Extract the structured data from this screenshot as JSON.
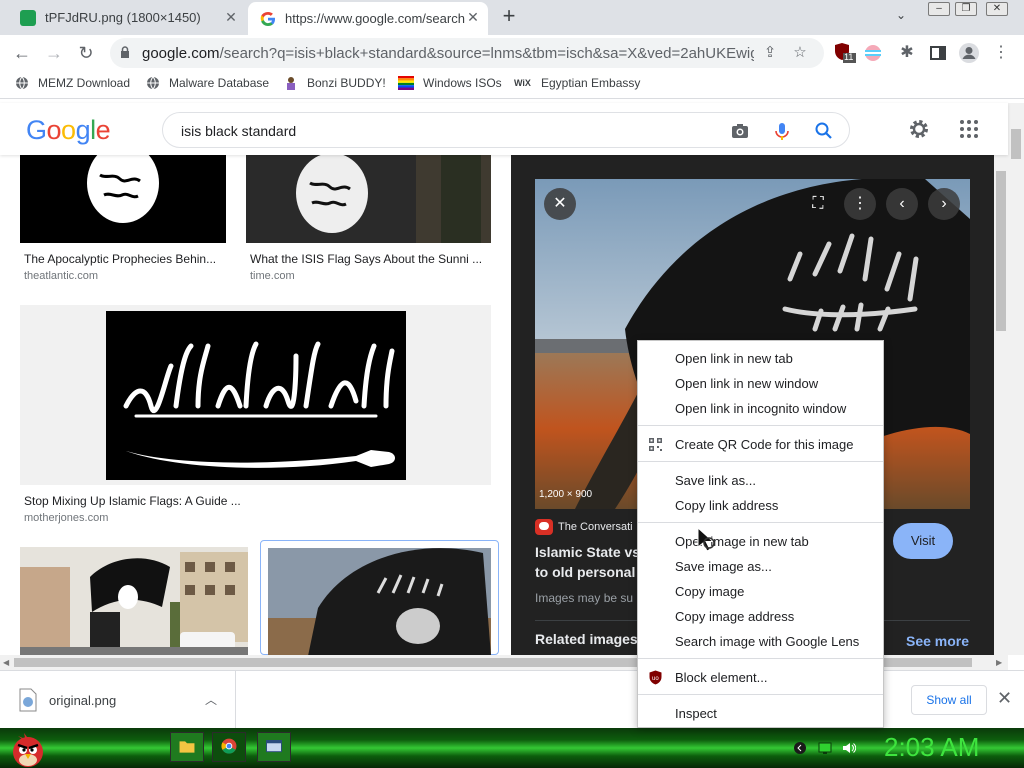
{
  "tabs": [
    {
      "title": "tPFJdRU.png (1800×1450)"
    },
    {
      "title": "https://www.google.com/search?"
    }
  ],
  "toolbar": {
    "url_host": "google.com",
    "url_path": "/search?q=isis+black+standard&source=lnms&tbm=isch&sa=X&ved=2ahUKEwigno...",
    "extension_badge": "11"
  },
  "bookmarks": [
    {
      "label": "MEMZ Download"
    },
    {
      "label": "Malware Database"
    },
    {
      "label": "Bonzi BUDDY!"
    },
    {
      "label": "Windows ISOs"
    },
    {
      "label": "Egyptian Embassy"
    }
  ],
  "google": {
    "logo": [
      "G",
      "o",
      "o",
      "g",
      "l",
      "e"
    ],
    "query": "isis black standard"
  },
  "results": [
    {
      "title": "The Apocalyptic Prophecies Behin...",
      "source": "theatlantic.com"
    },
    {
      "title": "What the ISIS Flag Says About the Sunni ...",
      "source": "time.com"
    },
    {
      "title": "Stop Mixing Up Islamic Flags: A Guide ...",
      "source": "motherjones.com"
    }
  ],
  "preview": {
    "dimensions": "1,200 × 900",
    "source": "The Conversati",
    "title_line1": "Islamic State vs",
    "title_line2": "to old personal",
    "visit": "Visit",
    "copyright": "Images may be su",
    "related": "Related images",
    "see_more": "See more"
  },
  "context_menu": {
    "items": [
      {
        "label": "Open link in new tab"
      },
      {
        "label": "Open link in new window"
      },
      {
        "label": "Open link in incognito window"
      },
      {
        "label": "Create QR Code for this image"
      },
      {
        "label": "Save link as..."
      },
      {
        "label": "Copy link address"
      },
      {
        "label": "Open image in new tab"
      },
      {
        "label": "Save image as..."
      },
      {
        "label": "Copy image"
      },
      {
        "label": "Copy image address"
      },
      {
        "label": "Search image with Google Lens"
      },
      {
        "label": "Block element..."
      },
      {
        "label": "Inspect"
      }
    ]
  },
  "downloads": {
    "filename": "original.png",
    "show_all": "Show all"
  },
  "taskbar": {
    "clock": "2:03 AM"
  },
  "colors": {
    "google_blue": "#4285f4",
    "google_red": "#ea4335",
    "google_yellow": "#fbbc05",
    "google_green": "#34a853",
    "link_blue": "#1a73e8",
    "preview_bg": "#222222",
    "visit_btn": "#8ab4f8",
    "clock_green": "#3ee43e"
  },
  "icons": [
    "search-icon",
    "camera-icon",
    "microphone-icon",
    "gear-icon",
    "apps-grid-icon",
    "lock-icon",
    "share-icon",
    "star-icon",
    "puzzle-icon",
    "sidepanel-icon",
    "profile-icon",
    "kebab-icon",
    "close-icon",
    "chevron-left-icon",
    "chevron-right-icon",
    "qr-code-icon",
    "ublock-icon",
    "png-file-icon",
    "angry-bird-icon",
    "folder-icon",
    "chrome-icon",
    "volume-icon",
    "network-icon"
  ]
}
